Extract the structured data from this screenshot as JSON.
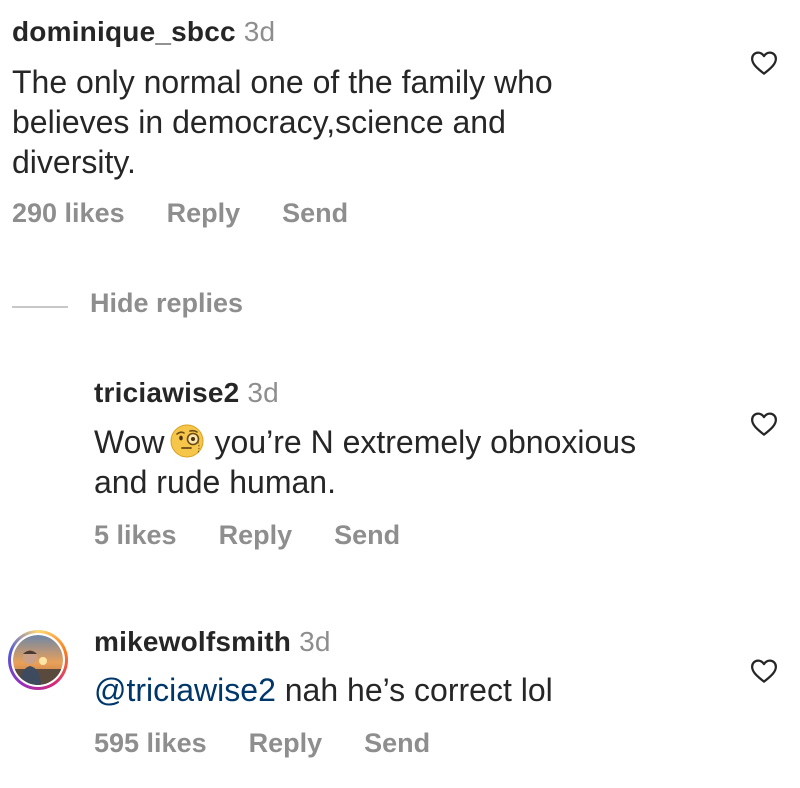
{
  "comments": [
    {
      "username": "dominique_sbcc",
      "time": "3d",
      "text_lines": [
        "The only normal one of the family who",
        "believes in democracy,science and",
        "diversity."
      ],
      "likes": "290 likes",
      "reply": "Reply",
      "send": "Send"
    }
  ],
  "hide_replies": "Hide replies",
  "replies": [
    {
      "username": "triciawise2",
      "time": "3d",
      "text_start": "Wow",
      "emoji": "face-with-monocle-emoji",
      "text_rest": "you’re N extremely obnoxious",
      "text_line2": "and rude human.",
      "likes": "5 likes",
      "reply": "Reply",
      "send": "Send"
    },
    {
      "username": "mikewolfsmith",
      "time": "3d",
      "mention": "@triciawise2",
      "text": " nah he’s correct lol",
      "likes": "595 likes",
      "reply": "Reply",
      "send": "Send"
    }
  ],
  "icons": {
    "like": "heart-outline-icon",
    "avatar": "user-avatar"
  },
  "colors": {
    "text": "#262626",
    "secondary": "#8e8e8e",
    "mention": "#00376b"
  }
}
